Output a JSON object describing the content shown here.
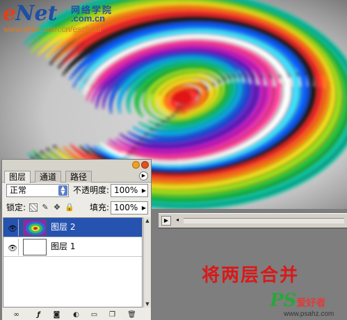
{
  "logo": {
    "brand_e": "e",
    "brand_net": "Net",
    "school_cn": "网络学院",
    "domain": ".com.cn",
    "url": "www.eNet.com.cn/eschool"
  },
  "panel": {
    "tabs": [
      "图层",
      "通道",
      "路径"
    ],
    "active_tab": "图层",
    "blend_mode": "正常",
    "opacity_label": "不透明度:",
    "opacity_value": "100%",
    "lock_label": "锁定:",
    "fill_label": "填充:",
    "fill_value": "100%",
    "layers": [
      {
        "name": "图层 2",
        "selected": true,
        "visible": true
      },
      {
        "name": "图层 1",
        "selected": false,
        "visible": true
      }
    ],
    "toolbar_icons": [
      "link-icon",
      "layer-style-icon",
      "mask-icon",
      "adjustment-icon",
      "group-folder-icon",
      "new-layer-icon",
      "trash-icon"
    ]
  },
  "caption": "将两层合并",
  "watermark": {
    "ps": "PS",
    "ai": "爱好者",
    "site": "www.psahz.com"
  },
  "colors": {
    "selection": "#2753b0",
    "caption_red": "#d91919",
    "close_btn": "#e05020",
    "min_btn": "#f0a020"
  }
}
